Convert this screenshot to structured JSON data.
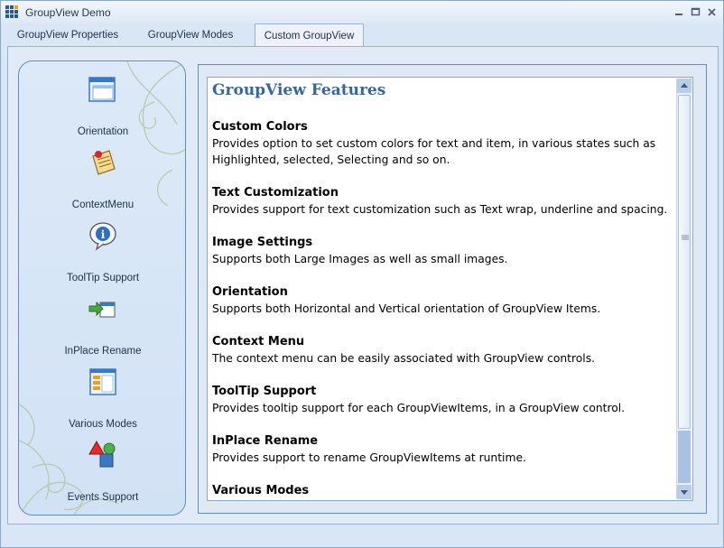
{
  "window": {
    "title": "GroupView Demo",
    "controls": [
      "minimize-icon",
      "maximize-icon",
      "close-icon"
    ]
  },
  "tabs": [
    {
      "label": "GroupView Properties",
      "active": false
    },
    {
      "label": "GroupView Modes",
      "active": false
    },
    {
      "label": "Custom GroupView",
      "active": true
    }
  ],
  "sidebar": {
    "items": [
      {
        "label": "Orientation",
        "icon": "orientation-icon"
      },
      {
        "label": "ContextMenu",
        "icon": "context-menu-icon"
      },
      {
        "label": "ToolTip Support",
        "icon": "tooltip-icon"
      },
      {
        "label": "InPlace Rename",
        "icon": "rename-icon"
      },
      {
        "label": "Various Modes",
        "icon": "modes-icon"
      },
      {
        "label": "Events Support",
        "icon": "events-icon"
      }
    ]
  },
  "content": {
    "title": "GroupView Features",
    "features": [
      {
        "heading": "Custom Colors",
        "lines": [
          "Provides option to set custom colors for text and item, in various states such as",
          "Highlighted, selected, Selecting and so on."
        ]
      },
      {
        "heading": "Text Customization",
        "lines": [
          "Provides support for text customization such as Text wrap, underline and spacing."
        ]
      },
      {
        "heading": "Image Settings",
        "lines": [
          "Supports both Large Images as well as small images."
        ]
      },
      {
        "heading": "Orientation",
        "lines": [
          "Supports both Horizontal and Vertical orientation of GroupView Items."
        ]
      },
      {
        "heading": "Context Menu",
        "lines": [
          "The context menu can be easily associated with GroupView controls."
        ]
      },
      {
        "heading": "ToolTip Support",
        "lines": [
          "Provides tooltip support for each GroupViewItems, in a GroupView control."
        ]
      },
      {
        "heading": "InPlace Rename",
        "lines": [
          "Provides support to rename GroupViewItems at runtime."
        ]
      },
      {
        "heading": "Various Modes",
        "lines": []
      }
    ]
  },
  "colors": {
    "accent": "#35679e",
    "border": "#5f8ec9",
    "window_bg": "#d9e6f5"
  }
}
